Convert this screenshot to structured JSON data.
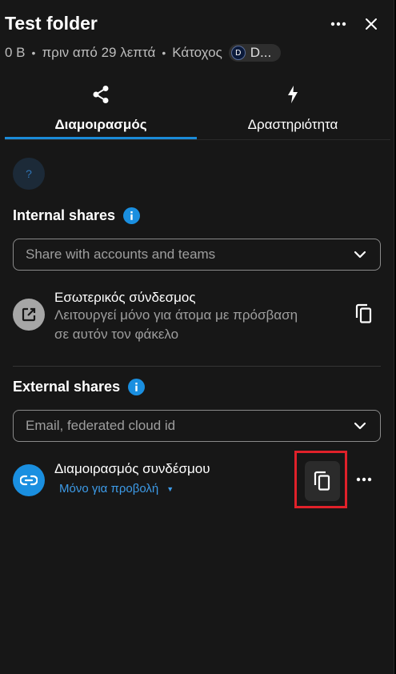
{
  "header": {
    "title": "Test folder",
    "size": "0 B",
    "modified": "πριν από 29 λεπτά",
    "owner_label": "Κάτοχος",
    "owner_initial": "D",
    "owner_name": "D..."
  },
  "tabs": [
    {
      "label": "Διαμοιρασμός",
      "icon": "share-icon",
      "active": true
    },
    {
      "label": "Δραστηριότητα",
      "icon": "lightning-icon",
      "active": false
    }
  ],
  "help_text": "?",
  "internal": {
    "title": "Internal shares",
    "placeholder": "Share with accounts and teams",
    "link_title": "Εσωτερικός σύνδεσμος",
    "link_sub_1": "Λειτουργεί μόνο για άτομα με πρόσβαση",
    "link_sub_2": "σε αυτόν τον φάκελο"
  },
  "external": {
    "title": "External shares",
    "placeholder": "Email, federated cloud id",
    "link_title": "Διαμοιρασμός συνδέσμου",
    "permission": "Μόνο για προβολή"
  },
  "colors": {
    "accent": "#1b8bd9",
    "link_blue": "#1a8fe0",
    "highlight": "#e0212a",
    "background": "#171717"
  }
}
